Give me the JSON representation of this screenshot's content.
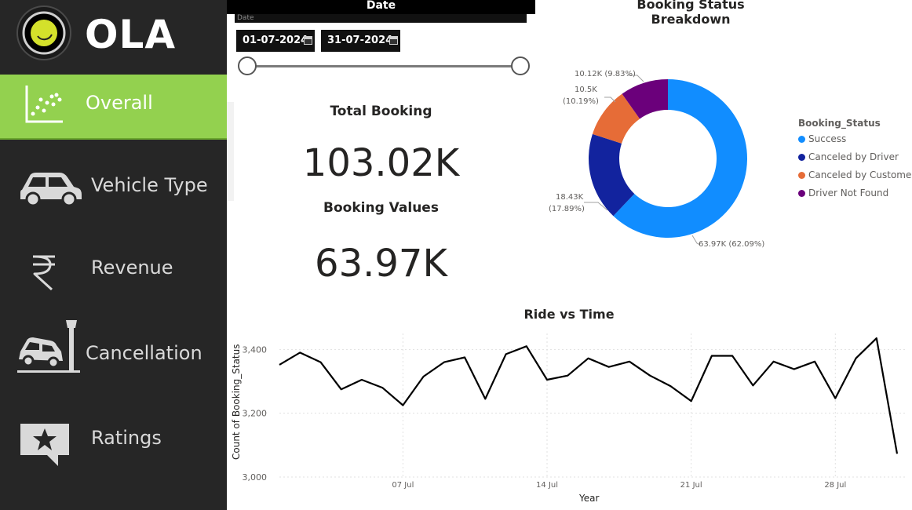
{
  "sidebar": {
    "logo_text": "OLA",
    "items": [
      {
        "label": "Overall",
        "icon": "scatter-chart-icon",
        "active": true
      },
      {
        "label": "Vehicle Type",
        "icon": "car-icon",
        "active": false
      },
      {
        "label": "Revenue",
        "icon": "rupee-icon",
        "active": false
      },
      {
        "label": "Cancellation",
        "icon": "car-crash-icon",
        "active": false
      },
      {
        "label": "Ratings",
        "icon": "star-review-icon",
        "active": false
      }
    ],
    "active_color": "#93d14f",
    "background": "#262626"
  },
  "date_filter": {
    "header": "Date",
    "sub_label": "Date",
    "start": "01-07-2024",
    "end": "31-07-2024"
  },
  "kpis": {
    "total_booking_label": "Total Booking",
    "total_booking_value": "103.02K",
    "booking_values_label": "Booking Values",
    "booking_values_value": "63.97K"
  },
  "donut": {
    "title": "Booking Status Breakdown",
    "legend_title": "Booking_Status",
    "labels": {
      "driver_not_found": "10.12K (9.83%)",
      "cust_line1": "10.5K",
      "cust_line2": "(10.19%)",
      "driver_line1": "18.43K",
      "driver_line2": "(17.89%)",
      "success": "63.97K (62.09%)"
    }
  },
  "line_chart": {
    "title": "Ride vs Time",
    "xlabel": "Year",
    "ylabel": "Count of Booking_Status",
    "yticks": [
      "3,000",
      "3,200",
      "3,400"
    ],
    "xticks": [
      "07 Jul",
      "14 Jul",
      "21 Jul",
      "28 Jul"
    ]
  },
  "chart_data": [
    {
      "type": "pie",
      "title": "Booking Status Breakdown",
      "legend_title": "Booking_Status",
      "legend_placement": "right",
      "categories": [
        "Success",
        "Canceled by Driver",
        "Canceled by Customer",
        "Driver Not Found"
      ],
      "values": [
        63970,
        18430,
        10500,
        10120
      ],
      "percent": [
        62.09,
        17.89,
        10.19,
        9.83
      ],
      "colors": [
        "#118dff",
        "#12239e",
        "#e66c37",
        "#6b007b"
      ],
      "donut": true
    },
    {
      "type": "line",
      "title": "Ride vs Time",
      "xlabel": "Year",
      "ylabel": "Count of Booking_Status",
      "ylim": [
        3000,
        3450
      ],
      "x_start": "2024-07-01",
      "x": [
        "01 Jul",
        "02 Jul",
        "03 Jul",
        "04 Jul",
        "05 Jul",
        "06 Jul",
        "07 Jul",
        "08 Jul",
        "09 Jul",
        "10 Jul",
        "11 Jul",
        "12 Jul",
        "13 Jul",
        "14 Jul",
        "15 Jul",
        "16 Jul",
        "17 Jul",
        "18 Jul",
        "19 Jul",
        "20 Jul",
        "21 Jul",
        "22 Jul",
        "23 Jul",
        "24 Jul",
        "25 Jul",
        "26 Jul",
        "27 Jul",
        "28 Jul",
        "29 Jul",
        "30 Jul",
        "31 Jul"
      ],
      "values": [
        3352,
        3390,
        3360,
        3275,
        3305,
        3280,
        3225,
        3315,
        3360,
        3375,
        3245,
        3385,
        3410,
        3305,
        3318,
        3372,
        3345,
        3362,
        3318,
        3285,
        3238,
        3380,
        3380,
        3287,
        3362,
        3338,
        3362,
        3247,
        3372,
        3435,
        3073
      ],
      "grid": true,
      "color": "#000000"
    }
  ]
}
